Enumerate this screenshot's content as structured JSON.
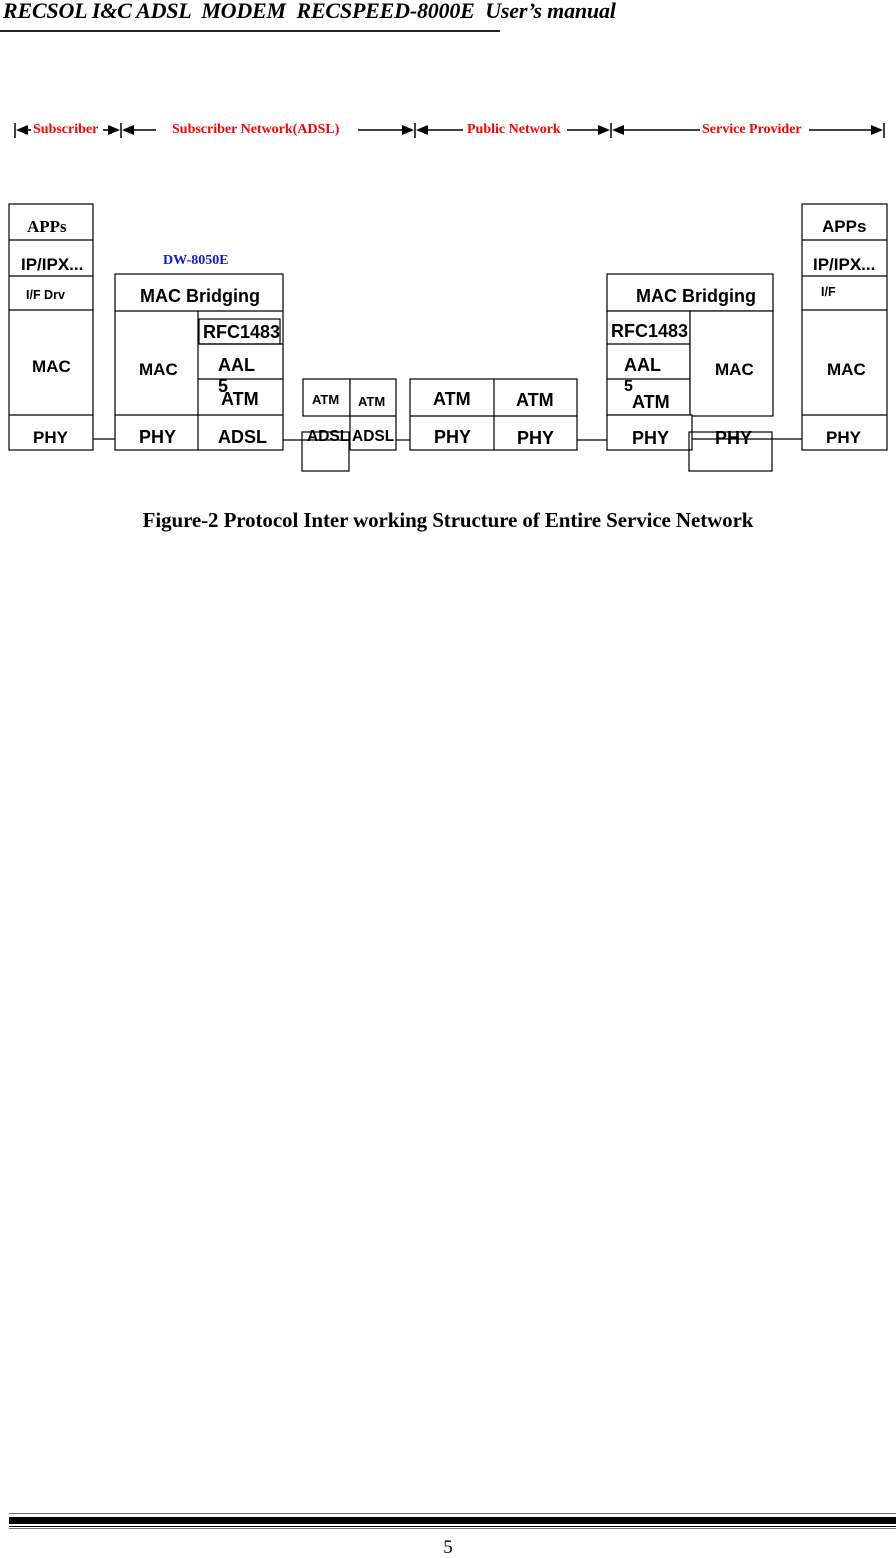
{
  "header": {
    "title": "RECSOL I&C ADSL  MODEM  RECSPEED-8000E  User’s manual"
  },
  "figure": {
    "domains": [
      "Subscriber",
      "Subscriber Network(ADSL)",
      "Public Network",
      "Service Provider"
    ],
    "device_label": "DW-8050E",
    "subscriber_host": {
      "apps": "APPs",
      "ip": "IP/IPX...",
      "ifdrv": "I/F Drv",
      "mac": "MAC",
      "phy": "PHY"
    },
    "modem": {
      "bridging": "MAC Bridging",
      "mac": "MAC",
      "phy": "PHY",
      "rfc": "RFC1483",
      "aal": "AAL",
      "aal_suffix": "5",
      "atm": "ATM",
      "adsl": "ADSL"
    },
    "dslam": {
      "atm_left": "ATM",
      "atm_right": "ATM",
      "adsl_left": "ADSL",
      "adsl_right": "ADSL"
    },
    "atm_switch": {
      "atm_left": "ATM",
      "atm_right": "ATM",
      "phy_left": "PHY",
      "phy_right": "PHY"
    },
    "provider_router": {
      "bridging": "MAC Bridging",
      "rfc": "RFC1483",
      "aal": "AAL",
      "aal_suffix": "5",
      "atm": "ATM",
      "mac": "MAC",
      "phy_left": "PHY",
      "phy_right": "PHY"
    },
    "provider_host": {
      "apps": "APPs",
      "ip": "IP/IPX...",
      "ifdrv": "I/F",
      "mac": "MAC",
      "phy": "PHY"
    }
  },
  "caption": "Figure-2 Protocol Inter working Structure of Entire Service Network",
  "footer": {
    "page_number": "5"
  },
  "colors": {
    "domain_label": "#ff0000",
    "device_label": "#1414d8",
    "lines": "#000000"
  }
}
